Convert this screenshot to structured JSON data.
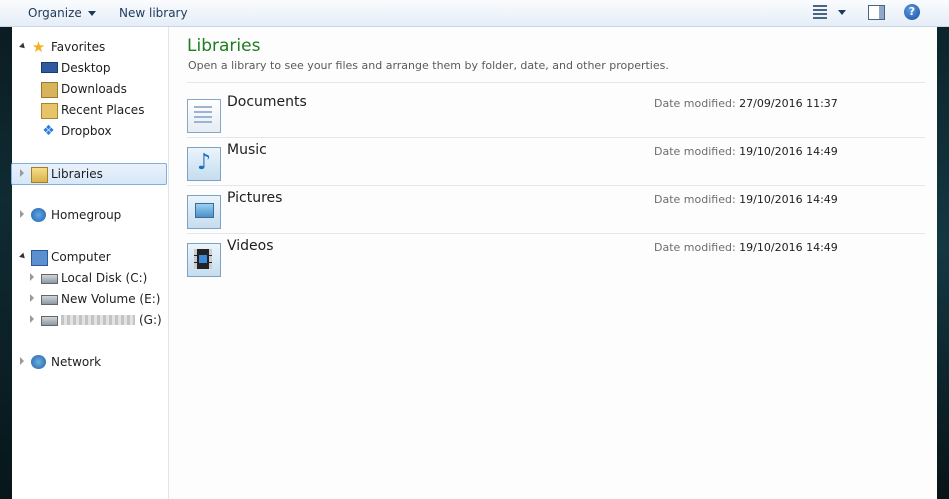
{
  "toolbar": {
    "organize_label": "Organize",
    "new_library_label": "New library",
    "help_glyph": "?"
  },
  "nav": {
    "favorites": {
      "label": "Favorites",
      "items": [
        {
          "label": "Desktop",
          "icon": "desktop-icon"
        },
        {
          "label": "Downloads",
          "icon": "downloads-icon"
        },
        {
          "label": "Recent Places",
          "icon": "recent-places-icon"
        },
        {
          "label": "Dropbox",
          "icon": "dropbox-icon"
        }
      ]
    },
    "libraries": {
      "label": "Libraries"
    },
    "homegroup": {
      "label": "Homegroup"
    },
    "computer": {
      "label": "Computer",
      "items": [
        {
          "label": "Local Disk (C:)",
          "icon": "local-disk-icon"
        },
        {
          "label": "New Volume (E:)",
          "icon": "drive-icon"
        },
        {
          "label": "(G:)",
          "icon": "removable-drive-icon"
        }
      ]
    },
    "network": {
      "label": "Network"
    }
  },
  "content": {
    "title": "Libraries",
    "subtitle": "Open a library to see your files and arrange them by folder, date, and other properties.",
    "meta_key": "Date modified:",
    "libraries": [
      {
        "name": "Documents",
        "date_modified": "27/09/2016 11:37",
        "icon": "documents-library-icon"
      },
      {
        "name": "Music",
        "date_modified": "19/10/2016 14:49",
        "icon": "music-library-icon"
      },
      {
        "name": "Pictures",
        "date_modified": "19/10/2016 14:49",
        "icon": "pictures-library-icon"
      },
      {
        "name": "Videos",
        "date_modified": "19/10/2016 14:49",
        "icon": "videos-library-icon"
      }
    ]
  },
  "colors": {
    "title_green": "#1e7d1e",
    "toolbar_text": "#1e395b",
    "selection_border": "#84acdd"
  }
}
